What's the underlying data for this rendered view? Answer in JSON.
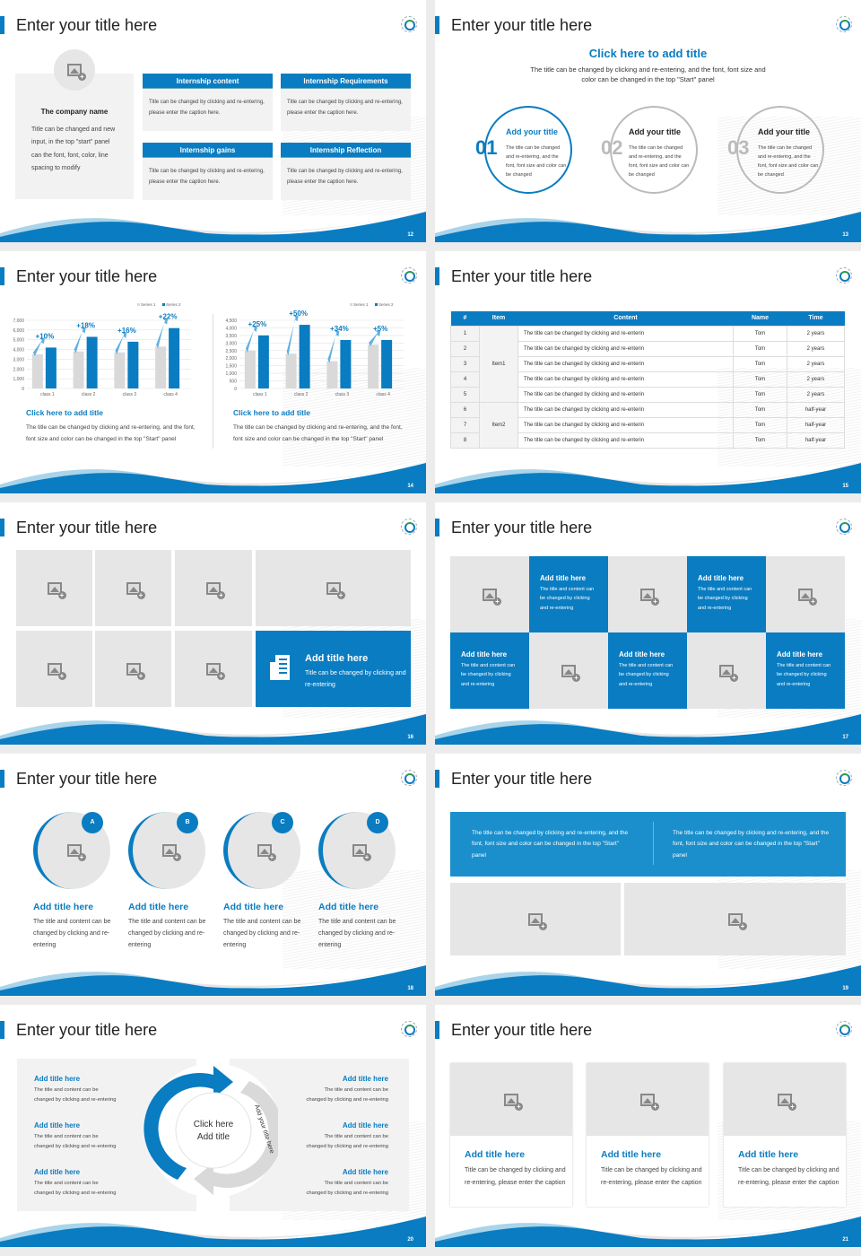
{
  "common": {
    "slide_title": "Enter your title here"
  },
  "slides": {
    "s12": {
      "page": "12",
      "company_name": "The company name",
      "company_desc": "Title can be changed and new input, in the top \"start\" panel can the font, font, color, line spacing to modify",
      "boxes": [
        {
          "title": "Internship content",
          "text": "Title can be changed by clicking and re-entering, please enter the caption here."
        },
        {
          "title": "Internship Requirements",
          "text": "Title can be changed by clicking and re-entering, please enter the caption here."
        },
        {
          "title": "Internship gains",
          "text": "Title can be changed by clicking and re-entering, please enter the caption here."
        },
        {
          "title": "Internship Reflection",
          "text": "Title can be changed by clicking and re-entering, please enter the caption here."
        }
      ]
    },
    "s13": {
      "page": "13",
      "heading": "Click here to add title",
      "desc": "The title can be changed by clicking and re-entering, and the font, font size and color can be changed in the top \"Start\" panel",
      "circles": [
        {
          "num": "01",
          "title": "Add your title",
          "text": "The title can be changed and re-entering, and the font, font size and color can be changed"
        },
        {
          "num": "02",
          "title": "Add your title",
          "text": "The title can be changed and re-entering, and the font, font size and color can be changed"
        },
        {
          "num": "03",
          "title": "Add your title",
          "text": "The title can be changed and re-entering, and the font, font size and color can be changed"
        }
      ]
    },
    "s14": {
      "page": "14",
      "captions": [
        {
          "title": "Click here to add title",
          "text": "The title can be changed by clicking and re-entering, and the font, font size and color can be changed in the top \"Start\" panel"
        },
        {
          "title": "Click here to add title",
          "text": "The title can be changed by clicking and re-entering, and the font, font size and color can be changed in the top \"Start\" panel"
        }
      ]
    },
    "s15": {
      "page": "15",
      "headers": [
        "#",
        "Item",
        "Content",
        "Name",
        "Time"
      ],
      "rows": [
        {
          "n": "1",
          "content": "The title can be changed by clicking and re-enterin",
          "name": "Tom",
          "time": "2 years"
        },
        {
          "n": "2",
          "content": "The title can be changed by clicking and re-enterin",
          "name": "Tom",
          "time": "2 years"
        },
        {
          "n": "3",
          "content": "The title can be changed by clicking and re-enterin",
          "name": "Tom",
          "time": "2 years"
        },
        {
          "n": "4",
          "content": "The title can be changed by clicking and re-enterin",
          "name": "Tom",
          "time": "2 years"
        },
        {
          "n": "5",
          "content": "The title can be changed by clicking and re-enterin",
          "name": "Tom",
          "time": "2 years"
        },
        {
          "n": "6",
          "content": "The title can be changed by clicking and re-enterin",
          "name": "Tom",
          "time": "half-year"
        },
        {
          "n": "7",
          "content": "The title can be changed by clicking and re-enterin",
          "name": "Tom",
          "time": "half-year"
        },
        {
          "n": "8",
          "content": "The title can be changed by clicking and re-enterin",
          "name": "Tom",
          "time": "half-year"
        }
      ],
      "groups": [
        "Item1",
        "Item2"
      ]
    },
    "s16": {
      "page": "16",
      "feature_title": "Add title here",
      "feature_text": "Title can be changed by clicking and re-entering"
    },
    "s17": {
      "page": "17",
      "tile_title": "Add title here",
      "tile_text": "The title and content can be changed by clicking and re-entering"
    },
    "s18": {
      "page": "18",
      "items": [
        {
          "badge": "A",
          "title": "Add title here",
          "text": "The title and content can be changed by clicking and re-entering"
        },
        {
          "badge": "B",
          "title": "Add title here",
          "text": "The title and content can be changed by clicking and re-entering"
        },
        {
          "badge": "C",
          "title": "Add title here",
          "text": "The title and content can be changed by clicking and re-entering"
        },
        {
          "badge": "D",
          "title": "Add title here",
          "text": "The title and content can be changed by clicking and re-entering"
        }
      ]
    },
    "s19": {
      "page": "19",
      "text_left": "The title can be changed by clicking and re-entering, and the font, font size and color can be changed in the top \"Start\" panel",
      "text_right": "The title can be changed by clicking and re-entering, and the font, font size and color can be changed in the top \"Start\" panel"
    },
    "s20": {
      "page": "20",
      "center": [
        "Click here",
        "Add title"
      ],
      "arc_left": "Add your title here",
      "arc_right": "Add your title here",
      "item_title": "Add title here",
      "item_text_1": "The title and content can be",
      "item_text_2": "changed by clicking and re-entering"
    },
    "s21": {
      "page": "21",
      "card_title": "Add title here",
      "card_text": "Title can be changed by clicking and re-entering, please enter the caption"
    }
  },
  "chart_data": [
    {
      "type": "bar",
      "categories": [
        "class 1",
        "class 2",
        "class 3",
        "class 4"
      ],
      "series": [
        {
          "name": "Series 1",
          "values": [
            3500,
            3800,
            3700,
            4300
          ]
        },
        {
          "name": "Series 2",
          "values": [
            4200,
            5300,
            4800,
            6200
          ]
        }
      ],
      "annotations": [
        "+10%",
        "+18%",
        "+16%",
        "+22%"
      ],
      "ylim": [
        0,
        7000
      ],
      "yticks": [
        "0",
        "1,000",
        "2,000",
        "3,000",
        "4,000",
        "5,000",
        "6,000",
        "7,000"
      ],
      "legend": "top-right",
      "grid": true,
      "colors": [
        "#d9d9d9",
        "#0a7cc1"
      ]
    },
    {
      "type": "bar",
      "categories": [
        "class 1",
        "class 2",
        "class 3",
        "class 4"
      ],
      "series": [
        {
          "name": "Series 1",
          "values": [
            2500,
            2300,
            1800,
            2900
          ]
        },
        {
          "name": "Series 2",
          "values": [
            3500,
            4200,
            3200,
            3200
          ]
        }
      ],
      "annotations": [
        "+25%",
        "+50%",
        "+34%",
        "+5%"
      ],
      "ylim": [
        0,
        4500
      ],
      "yticks": [
        "0",
        "500",
        "1,000",
        "1,500",
        "2,000",
        "2,500",
        "3,000",
        "3,500",
        "4,000",
        "4,500"
      ],
      "legend": "top-right",
      "grid": true,
      "colors": [
        "#d9d9d9",
        "#0a7cc1"
      ]
    }
  ]
}
